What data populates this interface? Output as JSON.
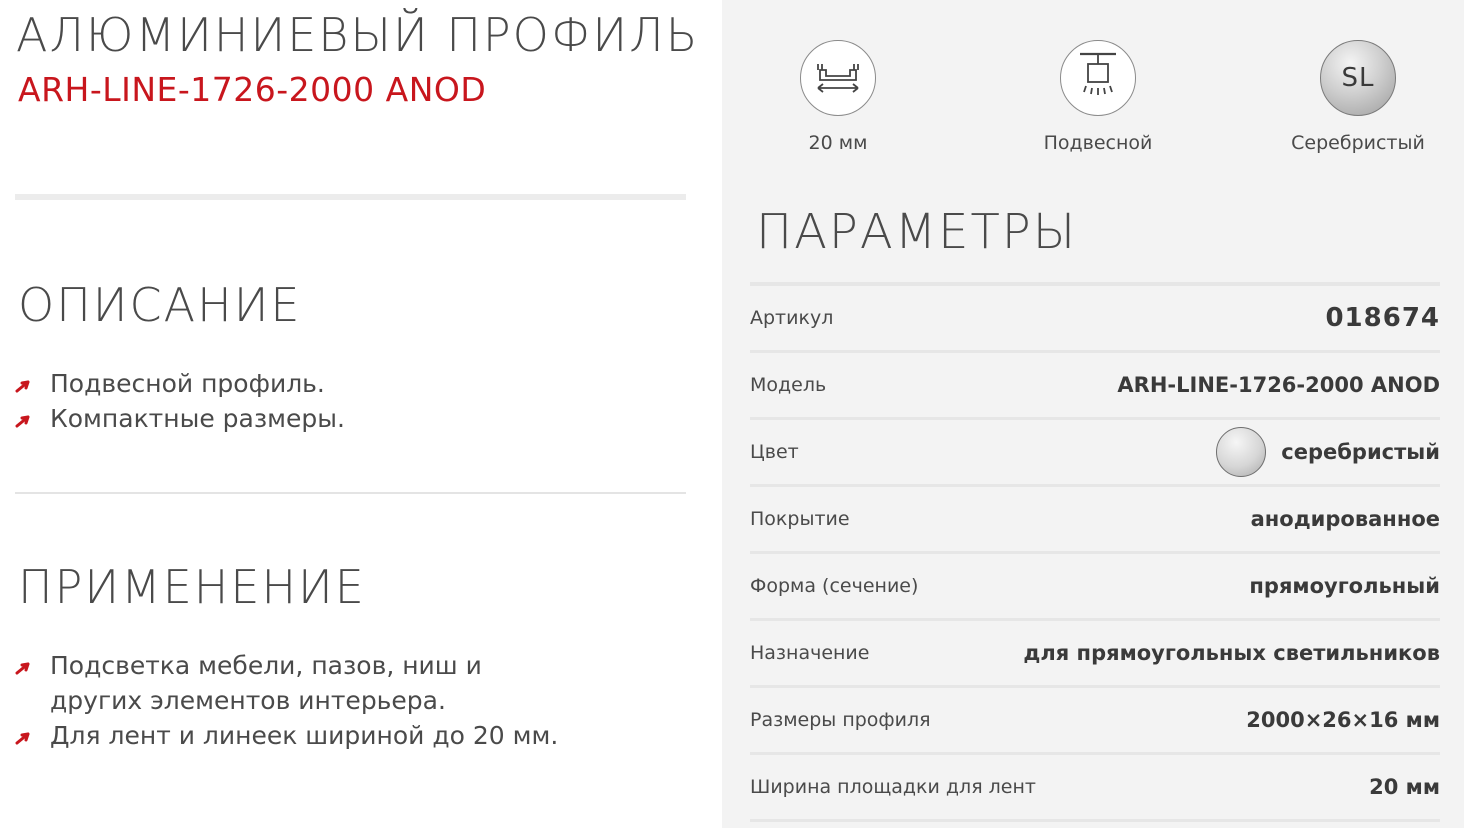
{
  "header": {
    "title": "АЛЮМИНИЕВЫЙ ПРОФИЛЬ",
    "model": "ARH-LINE-1726-2000 ANOD"
  },
  "description": {
    "title": "ОПИСАНИЕ",
    "items": [
      "Подвесной профиль.",
      "Компактные размеры."
    ]
  },
  "application": {
    "title": "ПРИМЕНЕНИЕ",
    "items": [
      "Подсветка мебели, пазов, ниш и других элементов интерьера.",
      "Для лент и линеек шириной до 20 мм."
    ]
  },
  "features": [
    {
      "icon": "tape-width-icon",
      "label": "20 мм"
    },
    {
      "icon": "suspended-mount-icon",
      "label": "Подвесной"
    },
    {
      "icon": "silver-color-icon",
      "badge": "SL",
      "label": "Серебристый"
    }
  ],
  "params": {
    "title": "ПАРАМЕТРЫ",
    "rows": [
      {
        "label": "Артикул",
        "value": "018674"
      },
      {
        "label": "Модель",
        "value": "ARH-LINE-1726-2000 ANOD"
      },
      {
        "label": "Цвет",
        "value": "серебристый"
      },
      {
        "label": "Покрытие",
        "value": "анодированное"
      },
      {
        "label": "Форма (сечение)",
        "value": "прямоугольный"
      },
      {
        "label": "Назначение",
        "value": "для прямоугольных светильников"
      },
      {
        "label": "Размеры профиля",
        "value": "2000×26×16 мм"
      },
      {
        "label": "Ширина площадки для лент",
        "value": "20 мм"
      }
    ]
  },
  "colors": {
    "accent": "#c8161d",
    "text": "#4a4a4a",
    "panel": "#f3f3f3"
  }
}
